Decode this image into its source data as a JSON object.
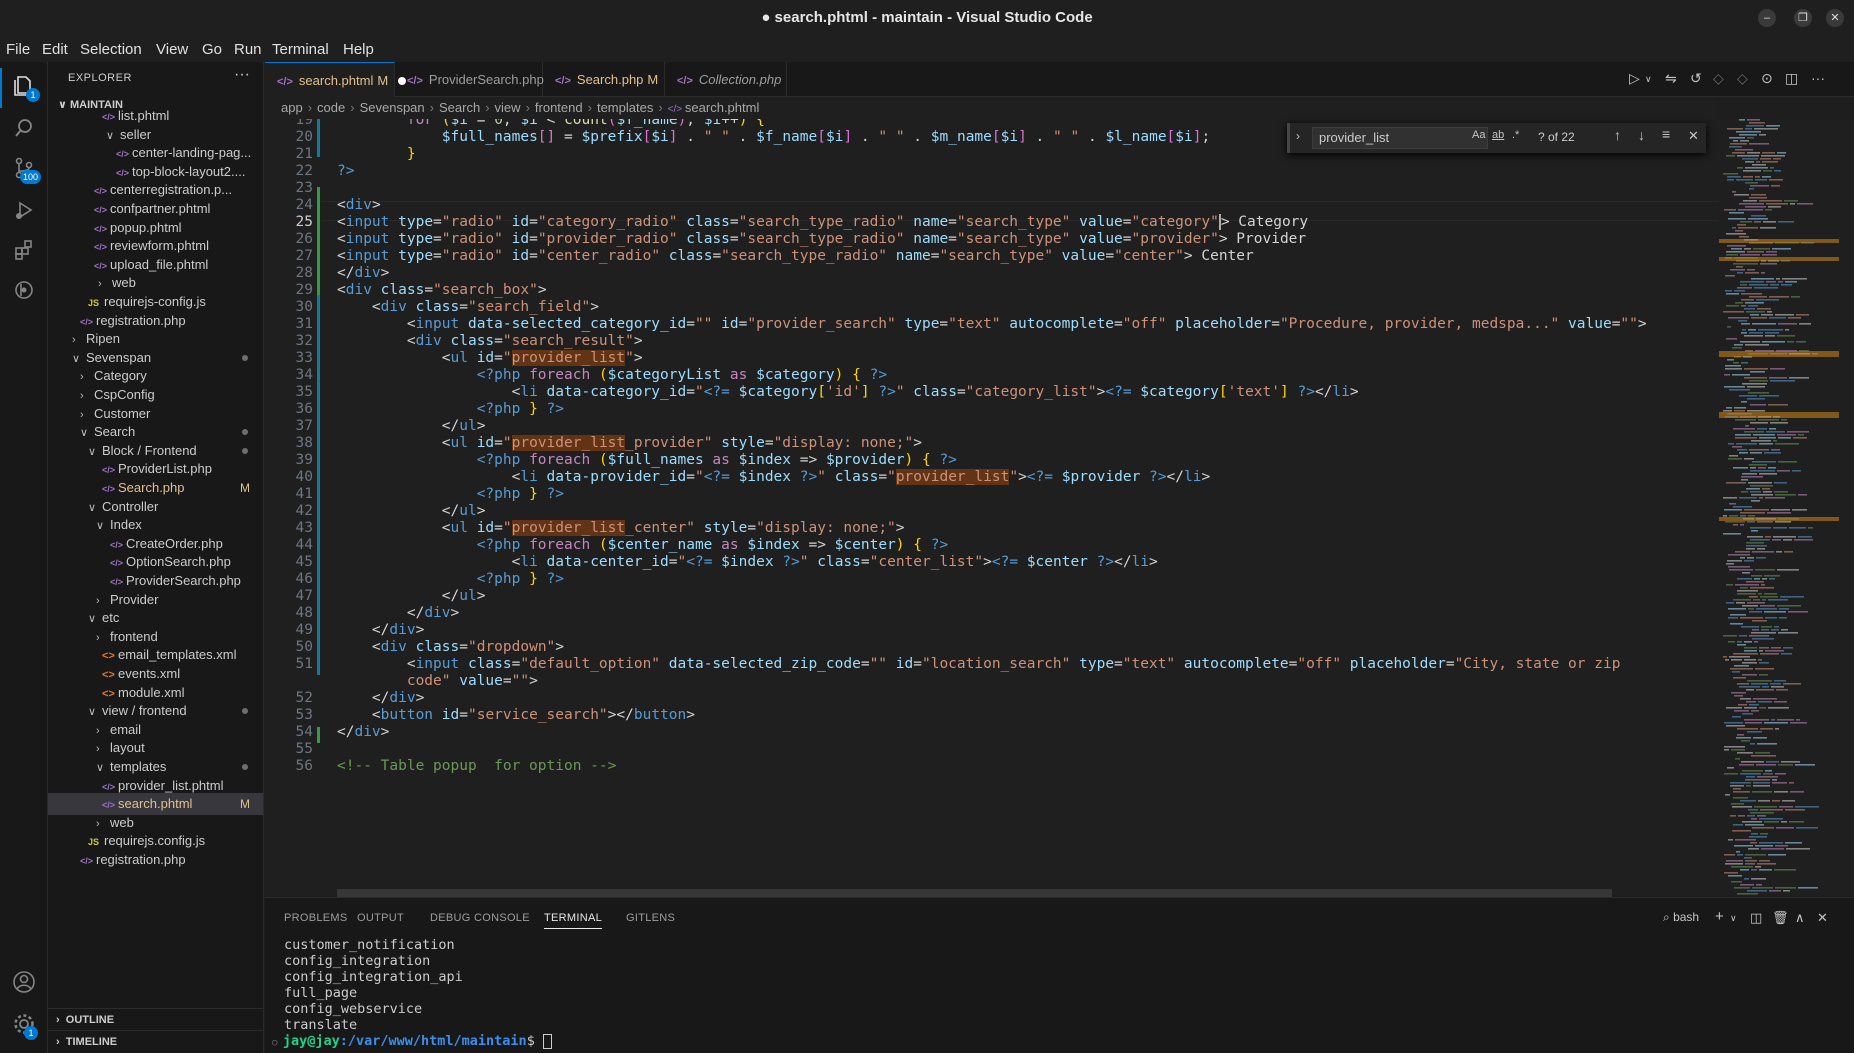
{
  "window": {
    "title": "● search.phtml - maintain - Visual Studio Code",
    "minimize": "–",
    "maximize": "❐",
    "close": "✕"
  },
  "menu": [
    "File",
    "Edit",
    "Selection",
    "View",
    "Go",
    "Run",
    "Terminal",
    "Help"
  ],
  "activity": {
    "explorer_badge": "1",
    "scm_badge": "100",
    "settings_badge": "1"
  },
  "sidebar": {
    "title": "EXPLORER",
    "more": "···",
    "root": "MAINTAIN",
    "rows": [
      {
        "label": "list.phtml",
        "icon": "php"
      },
      {
        "label": "seller",
        "chev": "∨"
      },
      {
        "label": "center-landing-pag...",
        "icon": "php"
      },
      {
        "label": "top-block-layout2....",
        "icon": "php"
      },
      {
        "label": "centerregistration.p...",
        "icon": "php"
      },
      {
        "label": "confpartner.phtml",
        "icon": "php"
      },
      {
        "label": "popup.phtml",
        "icon": "php"
      },
      {
        "label": "reviewform.phtml",
        "icon": "php"
      },
      {
        "label": "upload_file.phtml",
        "icon": "php"
      },
      {
        "label": "web",
        "chev": "›"
      },
      {
        "label": "requirejs-config.js",
        "icon": "js"
      },
      {
        "label": "registration.php",
        "icon": "php"
      },
      {
        "label": "Ripen",
        "chev": "›"
      },
      {
        "label": "Sevenspan",
        "chev": "∨"
      },
      {
        "label": "Category",
        "chev": "›"
      },
      {
        "label": "CspConfig",
        "chev": "›"
      },
      {
        "label": "Customer",
        "chev": "›"
      },
      {
        "label": "Search",
        "chev": "∨"
      },
      {
        "label": "Block / Frontend",
        "chev": "∨"
      },
      {
        "label": "ProviderList.php",
        "icon": "php"
      },
      {
        "label": "Search.php",
        "icon": "php",
        "status": "M"
      },
      {
        "label": "Controller",
        "chev": "∨"
      },
      {
        "label": "Index",
        "chev": "∨"
      },
      {
        "label": "CreateOrder.php",
        "icon": "php"
      },
      {
        "label": "OptionSearch.php",
        "icon": "php"
      },
      {
        "label": "ProviderSearch.php",
        "icon": "php"
      },
      {
        "label": "Provider",
        "chev": "›"
      },
      {
        "label": "etc",
        "chev": "∨"
      },
      {
        "label": "frontend",
        "chev": "›"
      },
      {
        "label": "email_templates.xml",
        "icon": "xml"
      },
      {
        "label": "events.xml",
        "icon": "xml"
      },
      {
        "label": "module.xml",
        "icon": "xml"
      },
      {
        "label": "view / frontend",
        "chev": "∨"
      },
      {
        "label": "email",
        "chev": "›"
      },
      {
        "label": "layout",
        "chev": "›"
      },
      {
        "label": "templates",
        "chev": "∨"
      },
      {
        "label": "provider_list.phtml",
        "icon": "php"
      },
      {
        "label": "search.phtml",
        "icon": "php",
        "status": "M"
      },
      {
        "label": "web",
        "chev": "›"
      },
      {
        "label": "requirejs.config.js",
        "icon": "js"
      },
      {
        "label": "registration.php",
        "icon": "php"
      }
    ],
    "outline": "OUTLINE",
    "timeline": "TIMELINE"
  },
  "tabs": [
    {
      "label": "search.phtml",
      "status": "M"
    },
    {
      "label": "ProviderSearch.php"
    },
    {
      "label": "Search.php",
      "status": "M"
    },
    {
      "label": "Collection.php"
    }
  ],
  "breadcrumb": [
    "app",
    "code",
    "Sevenspan",
    "Search",
    "view",
    "frontend",
    "templates",
    "search.phtml"
  ],
  "find": {
    "query": "provider_list",
    "match_case": "Aa",
    "whole_word": "ab",
    "regex": ".*",
    "count": "? of 22"
  },
  "editor": {
    "line_numbers": [
      "19",
      "20",
      "21",
      "22",
      "23",
      "24",
      "25",
      "26",
      "27",
      "28",
      "29",
      "30",
      "31",
      "32",
      "33",
      "34",
      "35",
      "36",
      "37",
      "38",
      "39",
      "40",
      "41",
      "42",
      "43",
      "44",
      "45",
      "46",
      "47",
      "48",
      "49",
      "50",
      "51",
      "",
      "52",
      "53",
      "54",
      "55",
      "56"
    ]
  },
  "panel": {
    "tabs": [
      "PROBLEMS",
      "OUTPUT",
      "DEBUG CONSOLE",
      "TERMINAL",
      "GITLENS"
    ],
    "shell": "bash",
    "lines": [
      "customer_notification",
      "config_integration",
      "config_integration_api",
      "full_page",
      "config_webservice",
      "translate"
    ],
    "prompt_user": "jay@jay",
    "prompt_path": ":/var/www/html/maintain",
    "prompt_symbol": "$ "
  }
}
